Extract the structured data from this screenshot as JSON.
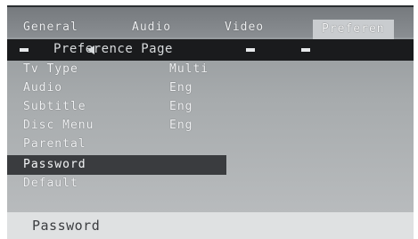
{
  "tabs": [
    {
      "label": "General"
    },
    {
      "label": "Audio"
    },
    {
      "label": "Video"
    },
    {
      "label": "Preferen"
    }
  ],
  "header": {
    "title": "Preference Page"
  },
  "items": [
    {
      "label": "Tv Type",
      "value": "Multi"
    },
    {
      "label": "Audio",
      "value": "Eng"
    },
    {
      "label": "Subtitle",
      "value": "Eng"
    },
    {
      "label": "Disc Menu",
      "value": "Eng"
    },
    {
      "label": "Parental",
      "value": ""
    },
    {
      "label": "Password",
      "value": ""
    },
    {
      "label": "Default",
      "value": ""
    }
  ],
  "selected_item": "Password",
  "status": {
    "text": "Password"
  },
  "colors": {
    "screen_bg": "#a7abad",
    "header_bg": "#1a1b1d",
    "selection_bg": "#3a3c3f",
    "text": "#f0f2f4",
    "status_bg": "#dfe1e2"
  }
}
